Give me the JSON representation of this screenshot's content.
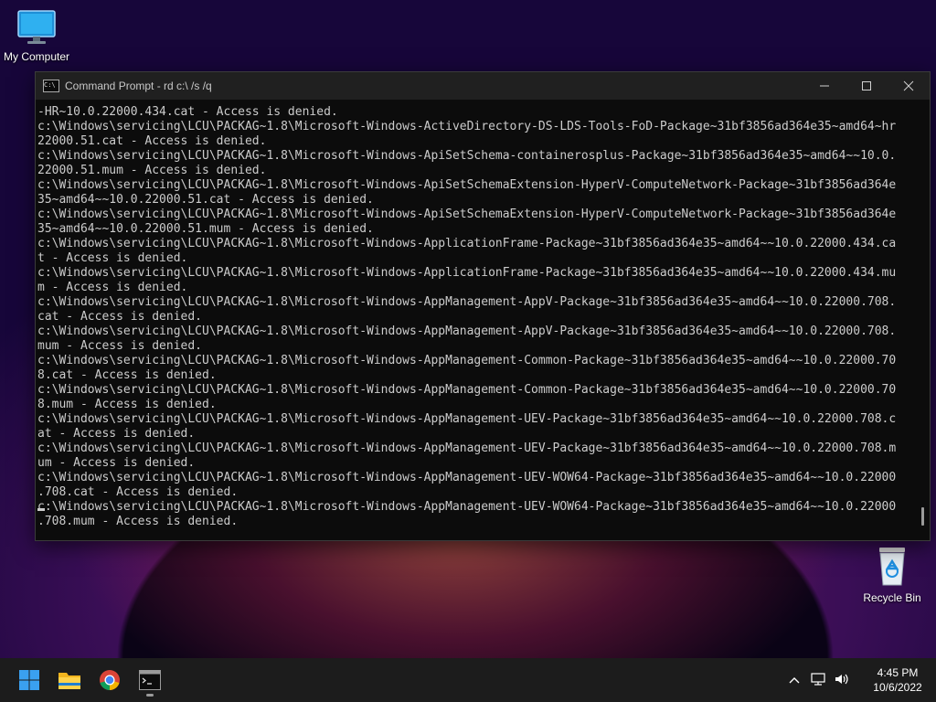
{
  "desktop": {
    "icons": [
      {
        "label": "My Computer",
        "icon": "monitor-icon"
      },
      {
        "label": "Recycle Bin",
        "icon": "recycle-bin-icon"
      }
    ]
  },
  "window": {
    "title": "Command Prompt - rd  c:\\ /s /q",
    "controls": [
      "minimize",
      "maximize",
      "close"
    ]
  },
  "console": {
    "lines": [
      "-HR~10.0.22000.434.cat - Access is denied.",
      "c:\\Windows\\servicing\\LCU\\PACKAG~1.8\\Microsoft-Windows-ActiveDirectory-DS-LDS-Tools-FoD-Package~31bf3856ad364e35~amd64~hr",
      "22000.51.cat - Access is denied.",
      "c:\\Windows\\servicing\\LCU\\PACKAG~1.8\\Microsoft-Windows-ApiSetSchema-containerosplus-Package~31bf3856ad364e35~amd64~~10.0.",
      "22000.51.mum - Access is denied.",
      "c:\\Windows\\servicing\\LCU\\PACKAG~1.8\\Microsoft-Windows-ApiSetSchemaExtension-HyperV-ComputeNetwork-Package~31bf3856ad364e",
      "35~amd64~~10.0.22000.51.cat - Access is denied.",
      "c:\\Windows\\servicing\\LCU\\PACKAG~1.8\\Microsoft-Windows-ApiSetSchemaExtension-HyperV-ComputeNetwork-Package~31bf3856ad364e",
      "35~amd64~~10.0.22000.51.mum - Access is denied.",
      "c:\\Windows\\servicing\\LCU\\PACKAG~1.8\\Microsoft-Windows-ApplicationFrame-Package~31bf3856ad364e35~amd64~~10.0.22000.434.ca",
      "t - Access is denied.",
      "c:\\Windows\\servicing\\LCU\\PACKAG~1.8\\Microsoft-Windows-ApplicationFrame-Package~31bf3856ad364e35~amd64~~10.0.22000.434.mu",
      "m - Access is denied.",
      "c:\\Windows\\servicing\\LCU\\PACKAG~1.8\\Microsoft-Windows-AppManagement-AppV-Package~31bf3856ad364e35~amd64~~10.0.22000.708.",
      "cat - Access is denied.",
      "c:\\Windows\\servicing\\LCU\\PACKAG~1.8\\Microsoft-Windows-AppManagement-AppV-Package~31bf3856ad364e35~amd64~~10.0.22000.708.",
      "mum - Access is denied.",
      "c:\\Windows\\servicing\\LCU\\PACKAG~1.8\\Microsoft-Windows-AppManagement-Common-Package~31bf3856ad364e35~amd64~~10.0.22000.70",
      "8.cat - Access is denied.",
      "c:\\Windows\\servicing\\LCU\\PACKAG~1.8\\Microsoft-Windows-AppManagement-Common-Package~31bf3856ad364e35~amd64~~10.0.22000.70",
      "8.mum - Access is denied.",
      "c:\\Windows\\servicing\\LCU\\PACKAG~1.8\\Microsoft-Windows-AppManagement-UEV-Package~31bf3856ad364e35~amd64~~10.0.22000.708.c",
      "at - Access is denied.",
      "c:\\Windows\\servicing\\LCU\\PACKAG~1.8\\Microsoft-Windows-AppManagement-UEV-Package~31bf3856ad364e35~amd64~~10.0.22000.708.m",
      "um - Access is denied.",
      "c:\\Windows\\servicing\\LCU\\PACKAG~1.8\\Microsoft-Windows-AppManagement-UEV-WOW64-Package~31bf3856ad364e35~amd64~~10.0.22000",
      ".708.cat - Access is denied.",
      "c:\\Windows\\servicing\\LCU\\PACKAG~1.8\\Microsoft-Windows-AppManagement-UEV-WOW64-Package~31bf3856ad364e35~amd64~~10.0.22000",
      ".708.mum - Access is denied."
    ]
  },
  "taskbar": {
    "apps": [
      "start-icon",
      "file-explorer-icon",
      "chrome-icon",
      "command-prompt-icon"
    ],
    "tray": {
      "icons": [
        "chevron-up-icon",
        "network-icon",
        "volume-icon"
      ],
      "time": "4:45 PM",
      "date": "10/6/2022"
    }
  }
}
